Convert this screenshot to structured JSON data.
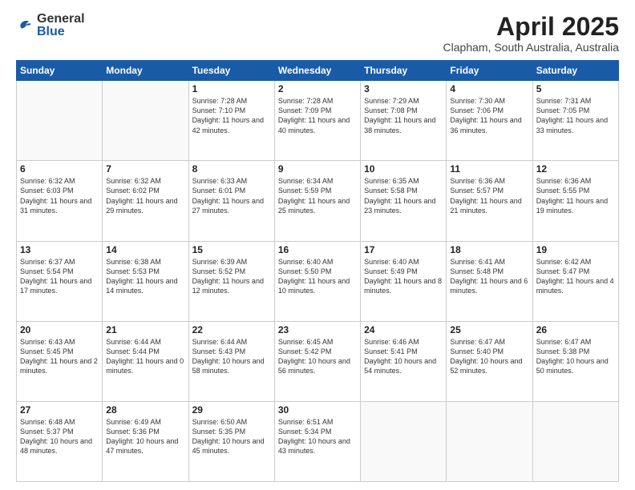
{
  "header": {
    "logo_general": "General",
    "logo_blue": "Blue",
    "month_title": "April 2025",
    "location": "Clapham, South Australia, Australia"
  },
  "days_of_week": [
    "Sunday",
    "Monday",
    "Tuesday",
    "Wednesday",
    "Thursday",
    "Friday",
    "Saturday"
  ],
  "weeks": [
    [
      null,
      null,
      {
        "day": 1,
        "sunrise": "7:28 AM",
        "sunset": "7:10 PM",
        "daylight": "11 hours and 42 minutes."
      },
      {
        "day": 2,
        "sunrise": "7:28 AM",
        "sunset": "7:09 PM",
        "daylight": "11 hours and 40 minutes."
      },
      {
        "day": 3,
        "sunrise": "7:29 AM",
        "sunset": "7:08 PM",
        "daylight": "11 hours and 38 minutes."
      },
      {
        "day": 4,
        "sunrise": "7:30 AM",
        "sunset": "7:06 PM",
        "daylight": "11 hours and 36 minutes."
      },
      {
        "day": 5,
        "sunrise": "7:31 AM",
        "sunset": "7:05 PM",
        "daylight": "11 hours and 33 minutes."
      }
    ],
    [
      {
        "day": 6,
        "sunrise": "6:32 AM",
        "sunset": "6:03 PM",
        "daylight": "11 hours and 31 minutes."
      },
      {
        "day": 7,
        "sunrise": "6:32 AM",
        "sunset": "6:02 PM",
        "daylight": "11 hours and 29 minutes."
      },
      {
        "day": 8,
        "sunrise": "6:33 AM",
        "sunset": "6:01 PM",
        "daylight": "11 hours and 27 minutes."
      },
      {
        "day": 9,
        "sunrise": "6:34 AM",
        "sunset": "5:59 PM",
        "daylight": "11 hours and 25 minutes."
      },
      {
        "day": 10,
        "sunrise": "6:35 AM",
        "sunset": "5:58 PM",
        "daylight": "11 hours and 23 minutes."
      },
      {
        "day": 11,
        "sunrise": "6:36 AM",
        "sunset": "5:57 PM",
        "daylight": "11 hours and 21 minutes."
      },
      {
        "day": 12,
        "sunrise": "6:36 AM",
        "sunset": "5:55 PM",
        "daylight": "11 hours and 19 minutes."
      }
    ],
    [
      {
        "day": 13,
        "sunrise": "6:37 AM",
        "sunset": "5:54 PM",
        "daylight": "11 hours and 17 minutes."
      },
      {
        "day": 14,
        "sunrise": "6:38 AM",
        "sunset": "5:53 PM",
        "daylight": "11 hours and 14 minutes."
      },
      {
        "day": 15,
        "sunrise": "6:39 AM",
        "sunset": "5:52 PM",
        "daylight": "11 hours and 12 minutes."
      },
      {
        "day": 16,
        "sunrise": "6:40 AM",
        "sunset": "5:50 PM",
        "daylight": "11 hours and 10 minutes."
      },
      {
        "day": 17,
        "sunrise": "6:40 AM",
        "sunset": "5:49 PM",
        "daylight": "11 hours and 8 minutes."
      },
      {
        "day": 18,
        "sunrise": "6:41 AM",
        "sunset": "5:48 PM",
        "daylight": "11 hours and 6 minutes."
      },
      {
        "day": 19,
        "sunrise": "6:42 AM",
        "sunset": "5:47 PM",
        "daylight": "11 hours and 4 minutes."
      }
    ],
    [
      {
        "day": 20,
        "sunrise": "6:43 AM",
        "sunset": "5:45 PM",
        "daylight": "11 hours and 2 minutes."
      },
      {
        "day": 21,
        "sunrise": "6:44 AM",
        "sunset": "5:44 PM",
        "daylight": "11 hours and 0 minutes."
      },
      {
        "day": 22,
        "sunrise": "6:44 AM",
        "sunset": "5:43 PM",
        "daylight": "10 hours and 58 minutes."
      },
      {
        "day": 23,
        "sunrise": "6:45 AM",
        "sunset": "5:42 PM",
        "daylight": "10 hours and 56 minutes."
      },
      {
        "day": 24,
        "sunrise": "6:46 AM",
        "sunset": "5:41 PM",
        "daylight": "10 hours and 54 minutes."
      },
      {
        "day": 25,
        "sunrise": "6:47 AM",
        "sunset": "5:40 PM",
        "daylight": "10 hours and 52 minutes."
      },
      {
        "day": 26,
        "sunrise": "6:47 AM",
        "sunset": "5:38 PM",
        "daylight": "10 hours and 50 minutes."
      }
    ],
    [
      {
        "day": 27,
        "sunrise": "6:48 AM",
        "sunset": "5:37 PM",
        "daylight": "10 hours and 48 minutes."
      },
      {
        "day": 28,
        "sunrise": "6:49 AM",
        "sunset": "5:36 PM",
        "daylight": "10 hours and 47 minutes."
      },
      {
        "day": 29,
        "sunrise": "6:50 AM",
        "sunset": "5:35 PM",
        "daylight": "10 hours and 45 minutes."
      },
      {
        "day": 30,
        "sunrise": "6:51 AM",
        "sunset": "5:34 PM",
        "daylight": "10 hours and 43 minutes."
      },
      null,
      null,
      null
    ]
  ],
  "labels": {
    "sunrise": "Sunrise:",
    "sunset": "Sunset:",
    "daylight": "Daylight:"
  }
}
